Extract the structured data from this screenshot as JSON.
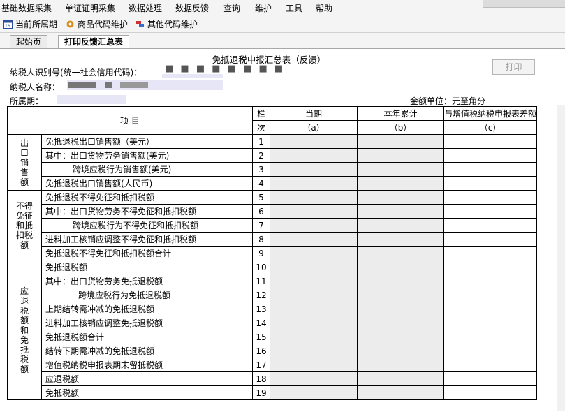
{
  "menubar": {
    "items": [
      "基础数据采集",
      "单证证明采集",
      "数据处理",
      "数据反馈",
      "查询",
      "维护",
      "工具",
      "帮助"
    ]
  },
  "toolbar": {
    "buttons": [
      {
        "label": "当前所属期",
        "icon": "calendar-icon"
      },
      {
        "label": "商品代码维护",
        "icon": "gear-icon"
      },
      {
        "label": "其他代码维护",
        "icon": "tools-icon"
      }
    ]
  },
  "tabs": [
    "起始页",
    "打印反馈汇总表"
  ],
  "report": {
    "title": "免抵退税申报汇总表（反馈）",
    "taxpayer_id_label": "纳税人识别号(统一社会信用代码)：",
    "taxpayer_name_label": "纳税人名称：",
    "period_label": "所属期：",
    "print_label": "打印",
    "unit_label": "金额单位：元至角分"
  },
  "table": {
    "header_item": "项 目",
    "header_lan": "栏",
    "header_ci": "次",
    "col_a": "当期",
    "col_b": "本年累计",
    "col_c": "与增值税纳税申报表差额",
    "col_a_sub": "（a）",
    "col_b_sub": "（b）",
    "col_c_sub": "（c）",
    "categories": [
      "出口销售额",
      "不得免征和抵扣税额",
      "应退税额和免抵税额"
    ],
    "rows": [
      {
        "label": "免抵退税出口销售额（美元）",
        "no": "1"
      },
      {
        "label": "其中：出口货物劳务销售额(美元)",
        "no": "2"
      },
      {
        "label": "跨境应税行为销售额(美元)",
        "no": "3"
      },
      {
        "label": "免抵退税出口销售额(人民币)",
        "no": "4"
      },
      {
        "label": "免抵退税不得免征和抵扣税额",
        "no": "5"
      },
      {
        "label": "其中：出口货物劳务不得免征和抵扣税额",
        "no": "6"
      },
      {
        "label": "跨境应税行为不得免征和抵扣税额",
        "no": "7"
      },
      {
        "label": "进料加工核销应调整不得免征和抵扣税额",
        "no": "8"
      },
      {
        "label": "免抵退税不得免征和抵扣税额合计",
        "no": "9"
      },
      {
        "label": "免抵退税额",
        "no": "10"
      },
      {
        "label": "其中：出口货物劳务免抵退税额",
        "no": "11"
      },
      {
        "label": "跨境应税行为免抵退税额",
        "no": "12"
      },
      {
        "label": "上期结转需冲减的免抵退税额",
        "no": "13"
      },
      {
        "label": "进料加工核销应调整免抵退税额",
        "no": "14"
      },
      {
        "label": "免抵退税额合计",
        "no": "15"
      },
      {
        "label": "结转下期需冲减的免抵退税额",
        "no": "16"
      },
      {
        "label": "增值税纳税申报表期末留抵税额",
        "no": "17"
      },
      {
        "label": "应退税额",
        "no": "18"
      },
      {
        "label": "免抵税额",
        "no": "19"
      }
    ]
  }
}
